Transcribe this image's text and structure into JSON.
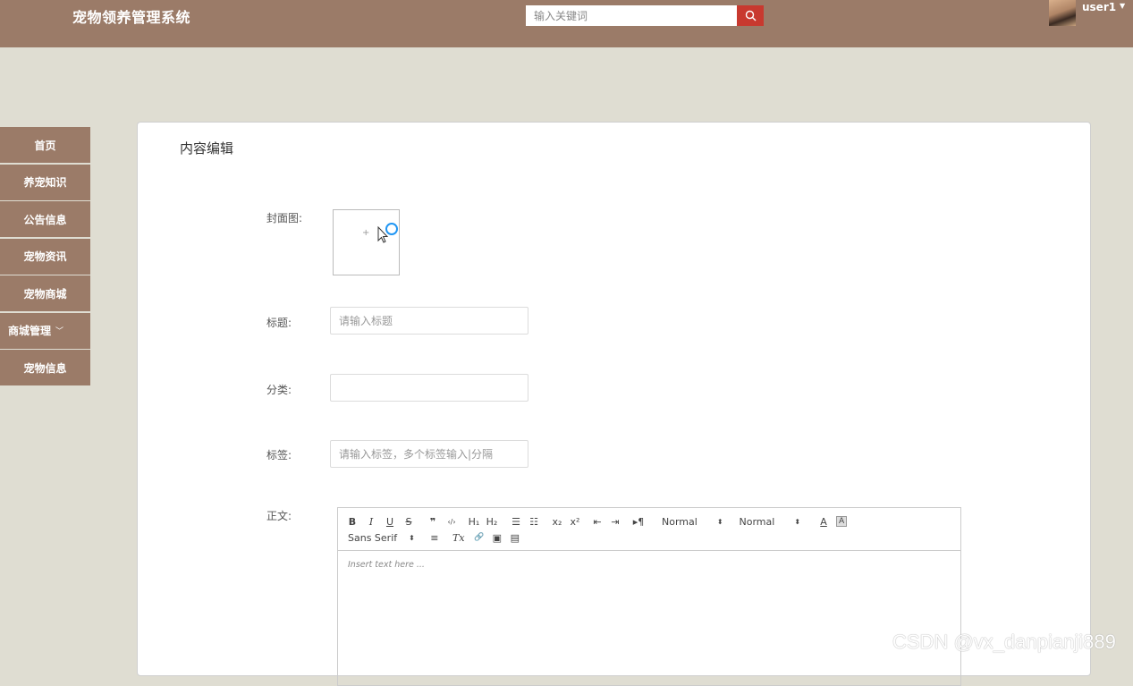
{
  "header": {
    "brand": "宠物领养管理系统",
    "search_placeholder": "输入关键词",
    "username": "user1"
  },
  "sidebar": {
    "items": [
      {
        "label": "首页"
      },
      {
        "label": "养宠知识"
      },
      {
        "label": "公告信息"
      },
      {
        "label": "宠物资讯"
      },
      {
        "label": "宠物商城"
      },
      {
        "label": "商城管理"
      },
      {
        "label": "宠物信息"
      }
    ]
  },
  "form": {
    "title": "内容编辑",
    "cover_label": "封面图:",
    "cover_plus": "+",
    "title_label": "标题:",
    "title_placeholder": "请输入标题",
    "category_label": "分类:",
    "category_value": "",
    "tags_label": "标签:",
    "tags_placeholder": "请输入标签，多个标签输入|分隔",
    "body_label": "正文:"
  },
  "editor": {
    "toolbar": {
      "bold": "B",
      "italic": "I",
      "underline": "U",
      "strike": "S",
      "blockquote": "❞",
      "code": "‹/›",
      "h1": "H₁",
      "h2": "H₂",
      "ordered_list": "☰",
      "bullet_list": "☷",
      "subscript": "x₂",
      "superscript": "x²",
      "outdent": "⇤",
      "indent": "⇥",
      "direction": "▸¶",
      "size_select": "Normal",
      "header_select": "Normal",
      "color": "A",
      "background": "A",
      "font_select": "Sans Serif",
      "align": "≡",
      "clean": "Tx",
      "link": "🔗",
      "image": "▣",
      "video": "▤"
    },
    "placeholder": "Insert text here ..."
  },
  "watermark": "CSDN @vx_danpianji889",
  "colors": {
    "header_bg": "#9b7b68",
    "page_bg": "#dfddd2",
    "search_button": "#c8392f",
    "cursor_ring": "#2196f3"
  },
  "icons": {
    "search": "search-icon",
    "user_menu": "caret-down-icon",
    "nav_expand": "chevron-down-icon",
    "cursor": "mouse-pointer-icon"
  }
}
